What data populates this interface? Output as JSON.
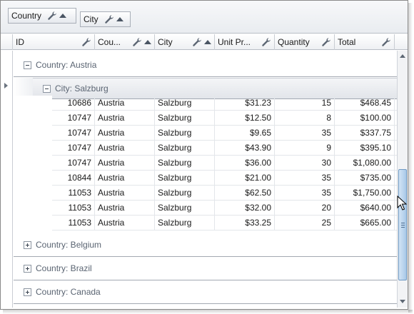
{
  "group_panel": {
    "chips": [
      {
        "label": "Country"
      },
      {
        "label": "City"
      }
    ]
  },
  "columns": [
    {
      "label": "ID"
    },
    {
      "label": "Cou..."
    },
    {
      "label": "City"
    },
    {
      "label": "Unit Pr..."
    },
    {
      "label": "Quantity"
    },
    {
      "label": "Total"
    }
  ],
  "groups": {
    "austria": "Country: Austria",
    "salzburg": "City: Salzburg",
    "belgium": "Country: Belgium",
    "brazil": "Country: Brazil",
    "canada": "Country: Canada"
  },
  "rows": [
    {
      "id": "10686",
      "country": "Austria",
      "city": "Salzburg",
      "unit_price": "$31.23",
      "quantity": "15",
      "total": "$468.45"
    },
    {
      "id": "10747",
      "country": "Austria",
      "city": "Salzburg",
      "unit_price": "$12.50",
      "quantity": "8",
      "total": "$100.00"
    },
    {
      "id": "10747",
      "country": "Austria",
      "city": "Salzburg",
      "unit_price": "$9.65",
      "quantity": "35",
      "total": "$337.75"
    },
    {
      "id": "10747",
      "country": "Austria",
      "city": "Salzburg",
      "unit_price": "$43.90",
      "quantity": "9",
      "total": "$395.10"
    },
    {
      "id": "10747",
      "country": "Austria",
      "city": "Salzburg",
      "unit_price": "$36.00",
      "quantity": "30",
      "total": "$1,080.00"
    },
    {
      "id": "10844",
      "country": "Austria",
      "city": "Salzburg",
      "unit_price": "$21.00",
      "quantity": "35",
      "total": "$735.00"
    },
    {
      "id": "11053",
      "country": "Austria",
      "city": "Salzburg",
      "unit_price": "$62.50",
      "quantity": "35",
      "total": "$1,750.00"
    },
    {
      "id": "11053",
      "country": "Austria",
      "city": "Salzburg",
      "unit_price": "$32.00",
      "quantity": "20",
      "total": "$640.00"
    },
    {
      "id": "11053",
      "country": "Austria",
      "city": "Salzburg",
      "unit_price": "$33.25",
      "quantity": "25",
      "total": "$665.00"
    }
  ],
  "icons": {
    "filter": "wrench-icon",
    "sort": "sort-ascending-icon",
    "expand": "expand-plus-icon",
    "collapse": "collapse-minus-icon"
  },
  "colors": {
    "scroll_thumb": "#a9c9e8",
    "group_text": "#5a6472",
    "border": "#a3a9b2"
  }
}
